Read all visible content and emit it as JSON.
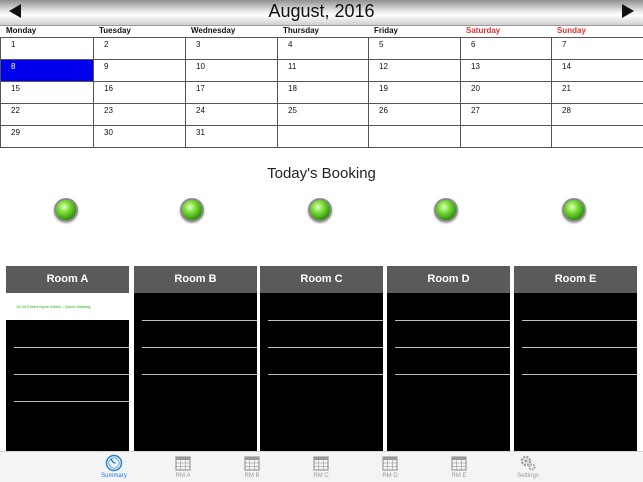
{
  "calendar": {
    "month_title": "August, 2016",
    "weekdays": [
      {
        "label": "Monday",
        "weekend": false
      },
      {
        "label": "Tuesday",
        "weekend": false
      },
      {
        "label": "Wednesday",
        "weekend": false
      },
      {
        "label": "Thursday",
        "weekend": false
      },
      {
        "label": "Friday",
        "weekend": false
      },
      {
        "label": "Saturday",
        "weekend": true
      },
      {
        "label": "Sunday",
        "weekend": true
      }
    ],
    "weeks": [
      [
        "1",
        "2",
        "3",
        "4",
        "5",
        "6",
        "7"
      ],
      [
        "8",
        "9",
        "10",
        "11",
        "12",
        "13",
        "14"
      ],
      [
        "15",
        "16",
        "17",
        "18",
        "19",
        "20",
        "21"
      ],
      [
        "22",
        "23",
        "24",
        "25",
        "26",
        "27",
        "28"
      ],
      [
        "29",
        "30",
        "31",
        "",
        "",
        "",
        ""
      ]
    ],
    "selected_day": "8",
    "selected_color": "#0000ee",
    "weekend_color": "#e23030"
  },
  "booking": {
    "title": "Today's Booking",
    "status_color": "#7fe13a"
  },
  "rooms": [
    {
      "name": "Room A",
      "booking_text": "10:30 Eileen Myrie Admin - Quick Meeting"
    },
    {
      "name": "Room B",
      "booking_text": ""
    },
    {
      "name": "Room C",
      "booking_text": ""
    },
    {
      "name": "Room D",
      "booking_text": ""
    },
    {
      "name": "Room E",
      "booking_text": ""
    }
  ],
  "tabs": [
    {
      "label": "Summary",
      "icon": "clock-icon",
      "active": true
    },
    {
      "label": "RM A",
      "icon": "calendar-icon",
      "active": false
    },
    {
      "label": "RM B",
      "icon": "calendar-icon",
      "active": false
    },
    {
      "label": "RM C",
      "icon": "calendar-icon",
      "active": false
    },
    {
      "label": "RM D",
      "icon": "calendar-icon",
      "active": false
    },
    {
      "label": "RM E",
      "icon": "calendar-icon",
      "active": false
    },
    {
      "label": "Settings",
      "icon": "gears-icon",
      "active": false
    }
  ],
  "colors": {
    "active_tab": "#1a7de0",
    "inactive_tab": "#9a9a9a",
    "room_header": "#5a5a5a"
  }
}
